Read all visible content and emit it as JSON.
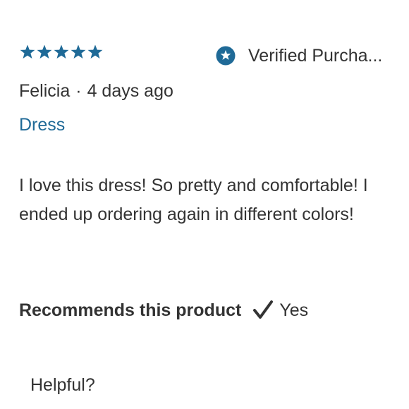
{
  "review": {
    "rating": 5,
    "rating_max": 5,
    "star_icon": "star-icon",
    "verified_label": "Verified Purcha...",
    "verified_icon": "verified-star-badge-icon",
    "author": "Felicia",
    "separator": "·",
    "date": "4 days ago",
    "variant": "Dress",
    "body": "I love this dress! So pretty and comfortable! I ended up ordering again in different colors!",
    "recommends_label": "Recommends this product",
    "recommends_icon": "checkmark-icon",
    "recommends_value": "Yes",
    "helpful_label": "Helpful?"
  },
  "colors": {
    "accent": "#1f6a97",
    "text": "#333333"
  }
}
